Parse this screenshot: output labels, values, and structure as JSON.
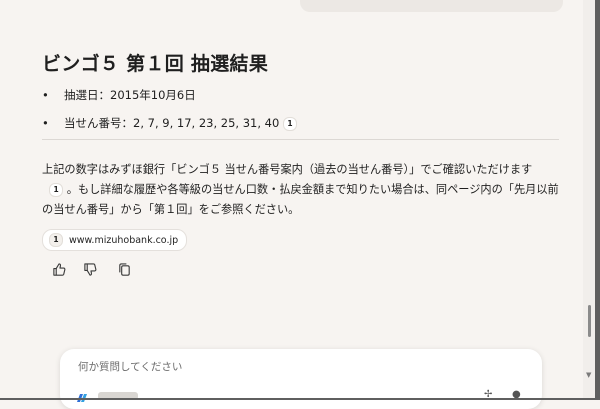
{
  "answer": {
    "heading": "ビンゴ５ 第１回 抽選結果",
    "draw_date_label": "抽選日：2015年10月6日",
    "winning_numbers_label": "当せん番号：2, 7, 9, 17, 23, 25, 31, 40",
    "citation_marker": "1",
    "paragraph_part1": "上記の数字はみずほ銀行「ビンゴ５ 当せん番号案内（過去の当せん番号）」でご確認いただけます",
    "paragraph_part2": "。もし詳細な履歴や各等級の当せん口数・払戻金額まで知りたい場合は、同ページ内の「先月以前の当せん番号」から「第１回」をご参照ください。"
  },
  "source": {
    "index": "1",
    "domain": "www.mizuhobank.co.jp"
  },
  "input": {
    "placeholder": "何か質問してください"
  }
}
